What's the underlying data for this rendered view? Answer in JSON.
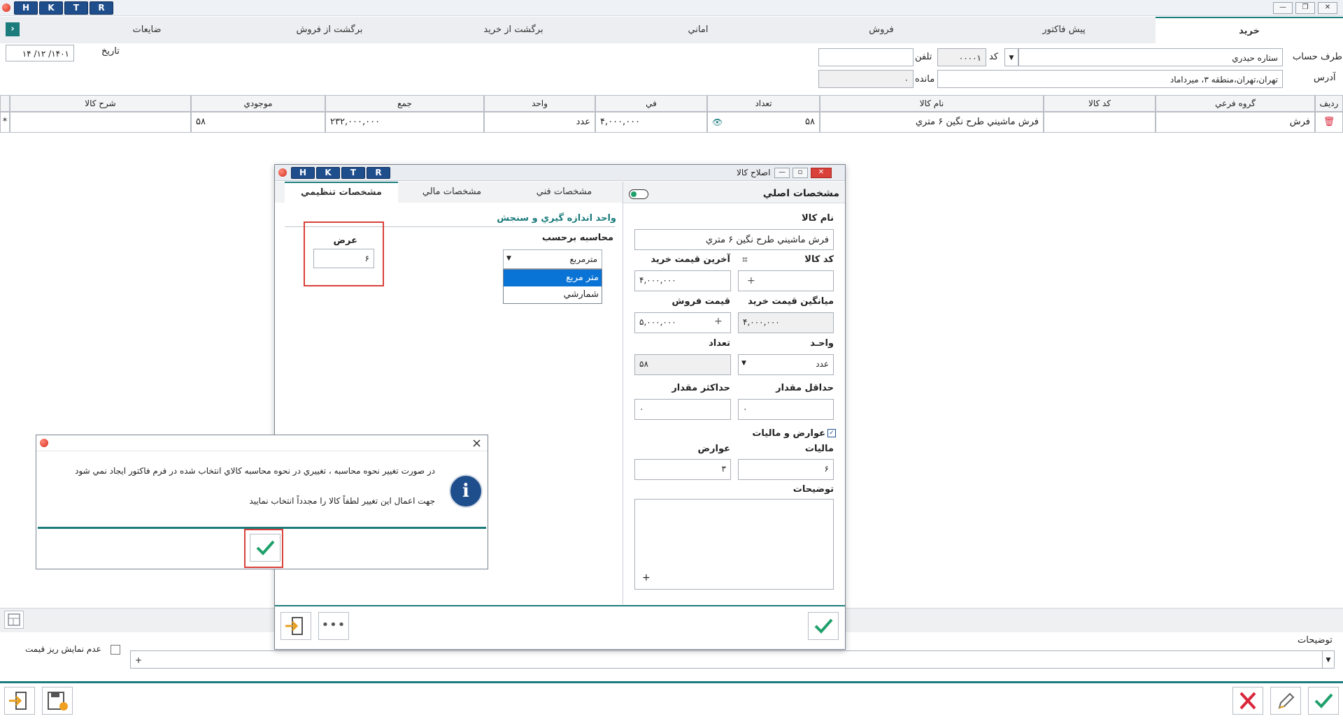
{
  "titlebar": {
    "buttons": [
      "H",
      "K",
      "T",
      "R"
    ]
  },
  "tabs": [
    {
      "label": "خريد",
      "active": true
    },
    {
      "label": "پيش فاکتور"
    },
    {
      "label": "فروش"
    },
    {
      "label": "اماني"
    },
    {
      "label": "برگشت از خريد"
    },
    {
      "label": "برگشت از فروش"
    },
    {
      "label": "ضايعات"
    }
  ],
  "header": {
    "account_label": "طرف حساب",
    "account_value": "ستاره حيدري",
    "code_label": "کد",
    "code_value": "۰۰۰۰۱",
    "phone_label": "تلفن",
    "phone_value": "",
    "address_label": "آدرس",
    "address_value": "تهران،تهران،منطقه ۳، ميرداماد",
    "balance_label": "مانده",
    "balance_value": "۰",
    "date_label": "تاريخ",
    "date_value": "۱۴۰۱/ ۱۲/ ۱۴"
  },
  "grid": {
    "headers": [
      "رديف",
      "گروه فرعي",
      "کد کالا",
      "نام کالا",
      "تعداد",
      "في",
      "واحد",
      "جمع",
      "موجودي",
      "شرح کالا"
    ],
    "row": {
      "group": "فرش",
      "code": "",
      "name": "فرش ماشيني طرح نگين ۶ متري",
      "qty": "۵۸",
      "price": "۴,۰۰۰,۰۰۰",
      "unit": "عدد",
      "total": "۲۳۲,۰۰۰,۰۰۰",
      "stock": "۵۸",
      "desc": "",
      "marker": "*"
    }
  },
  "dialog": {
    "title": "اصلاح کالا",
    "buttons": [
      "H",
      "K",
      "T",
      "R"
    ],
    "tabs": {
      "main": "مشخصات اصلي",
      "technical": "مشخصات فني",
      "financial": "مشخصات مالي",
      "settings": "مشخصات تنظيمي"
    },
    "fields": {
      "name_label": "نام کالا",
      "name_value": "فرش ماشيني طرح نگين ۶ متري",
      "code_label": "کد کالا",
      "code_value": "",
      "last_price_label": "آخرين قيمت خريد",
      "last_price_value": "۴,۰۰۰,۰۰۰",
      "avg_price_label": "ميانگين قيمت خريد",
      "avg_price_value": "۴,۰۰۰,۰۰۰",
      "sale_price_label": "قيمت فروش",
      "sale_price_value": "۵,۰۰۰,۰۰۰",
      "unit_label": "واحـد",
      "unit_value": "عدد",
      "qty_label": "تعداد",
      "qty_value": "۵۸",
      "min_label": "حداقل مقدار",
      "min_value": "۰",
      "max_label": "حداکثر مقدار",
      "max_value": "۰",
      "tax_section": "عوارض و ماليات",
      "tax_label": "ماليات",
      "tax_value": "۶",
      "duty_label": "عوارض",
      "duty_value": "۳",
      "notes_label": "توضيحات",
      "notes_plus": "+"
    },
    "settings": {
      "section_title": "واحد اندازه گيري و سنجش",
      "calc_label": "محاسبه برحسب",
      "calc_value": "مترمربع",
      "options": [
        "متر مربع",
        "شمارشي"
      ],
      "width_label": "عرض",
      "width_value": "۶"
    }
  },
  "message": {
    "line1": "در صورت تغيير نحوه محاسبه ، تغييري در نحوه محاسبه کالاي انتخاب شده در فرم فاکتور ايجاد نمي شود",
    "line2": "جهت اعمال اين تغيير لطفاً کالا را مجدداً انتخاب نماييد",
    "close": "×"
  },
  "footer": {
    "notes_label": "توضيحات",
    "notes_plus": "+",
    "hide_price_label": "عدم نمايش ريز قيمت"
  },
  "colors": {
    "accent": "#1c7c7c",
    "brand_blue": "#1f4e8c",
    "ok_green": "#1fa06a",
    "cancel_red": "#d9263a",
    "highlight_red": "#d9403a",
    "select_blue": "#0a74d6"
  }
}
